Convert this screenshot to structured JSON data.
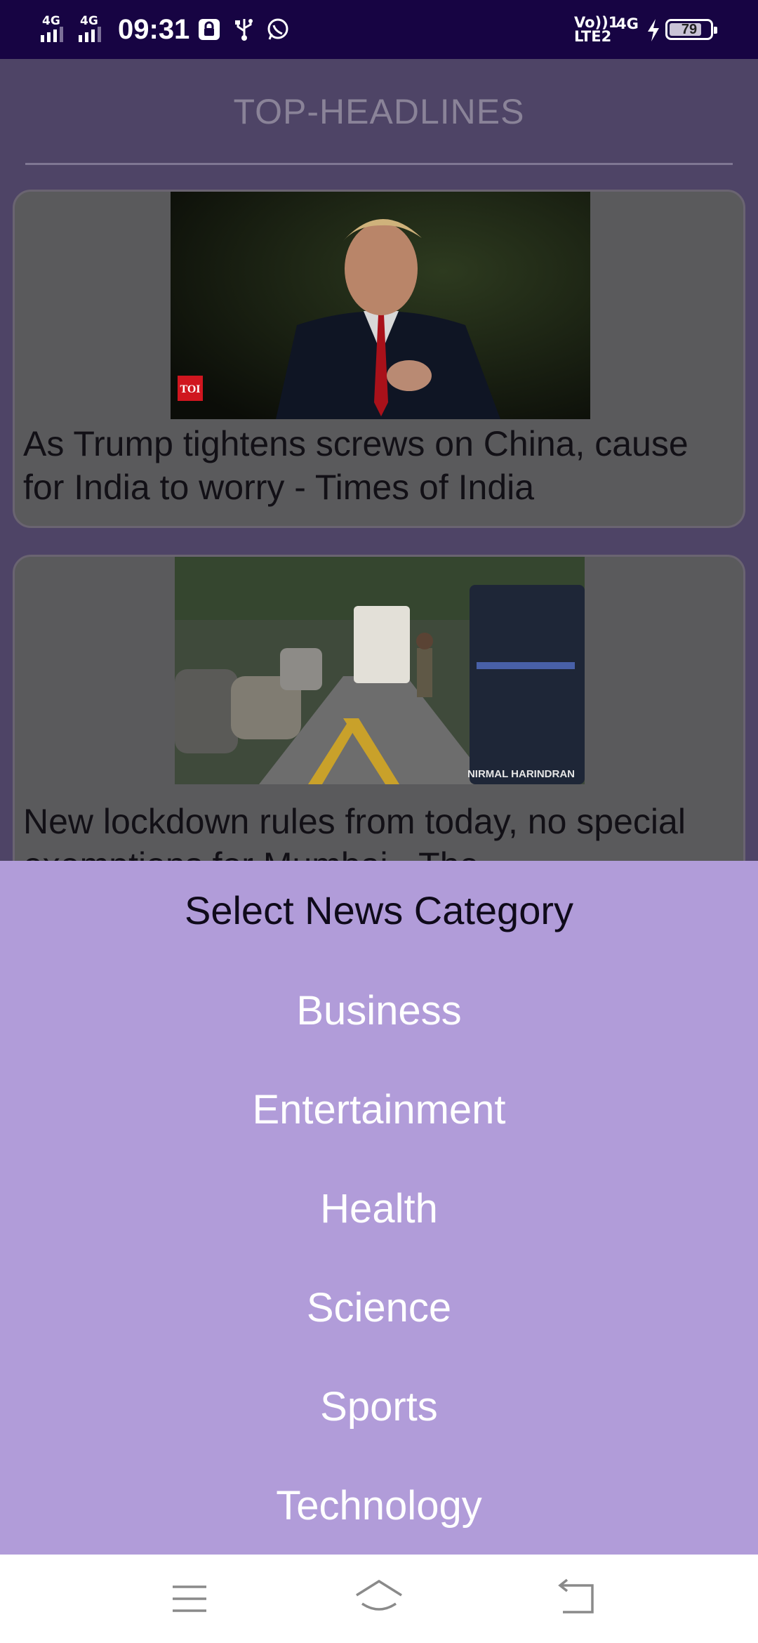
{
  "status_bar": {
    "sim1_network": "4G",
    "sim2_network": "4G",
    "time": "09:31",
    "volte_line1": "Vo))1",
    "volte_line2": "LTE2",
    "data_network": "4G",
    "battery_level": "79",
    "icons": [
      "lock-screen-icon",
      "usb-icon",
      "whatsapp-icon",
      "charging-bolt-icon"
    ]
  },
  "page": {
    "title": "TOP-HEADLINES",
    "articles": [
      {
        "headline": "As Trump tightens screws on China, cause for India to worry - Times of India",
        "image_badge": "TOI"
      },
      {
        "headline": "New lockdown rules from today, no special exemptions for Mumbai - The",
        "image_caption": "NIRMAL HARINDRAN"
      }
    ]
  },
  "category_sheet": {
    "title": "Select News Category",
    "options": [
      "Business",
      "Entertainment",
      "Health",
      "Science",
      "Sports",
      "Technology"
    ]
  },
  "navbar": {
    "buttons": [
      "menu-icon",
      "home-icon",
      "back-icon"
    ]
  },
  "colors": {
    "status_bar_bg": "#170443",
    "sheet_bg": "#b19cd9",
    "dim_overlay": "#4e4466"
  }
}
